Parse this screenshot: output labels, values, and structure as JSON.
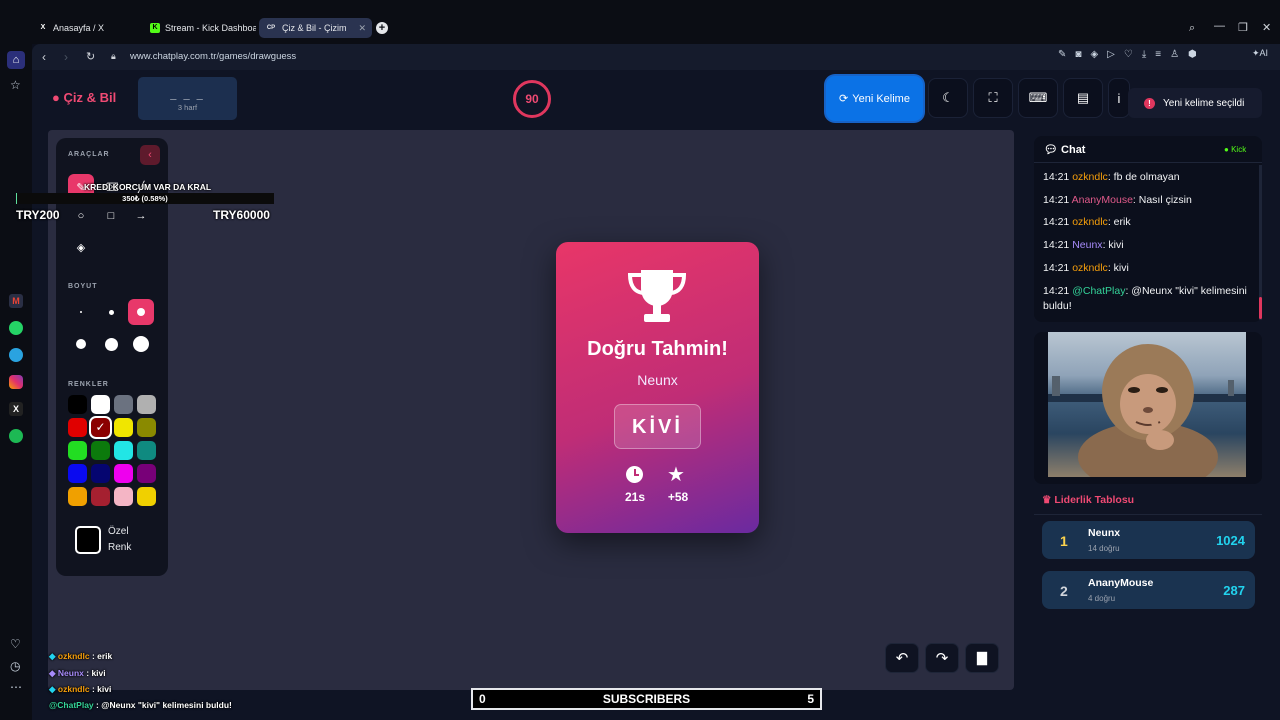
{
  "browser": {
    "tabs": [
      {
        "label": "Anasayfa / X",
        "favicon": "X"
      },
      {
        "label": "Stream - Kick Dashboard",
        "favicon": "K"
      },
      {
        "label": "Çiz & Bil - Çizim Oyun",
        "favicon": "CP"
      }
    ],
    "url": "www.chatplay.com.tr/games/drawguess",
    "ai_label": "AI"
  },
  "app": {
    "logo": "Çiz & Bil",
    "word_mask": "_ _ _",
    "word_hint": "3 harf",
    "timer": "90",
    "new_word_label": "Yeni Kelime",
    "toast": "Yeni kelime seçildi"
  },
  "tools": {
    "section_tools": "ARAÇLAR",
    "section_size": "BOYUT",
    "section_colors": "RENKLER",
    "custom_color_line1": "Özel",
    "custom_color_line2": "Renk",
    "colors": [
      "#000000",
      "#ffffff",
      "#6b7280",
      "#b0b0b0",
      "#e00000",
      "#8b0000",
      "#f0e600",
      "#8a8a00",
      "#22dd22",
      "#0c7a0c",
      "#22e5e5",
      "#0f8a80",
      "#0a0af0",
      "#050570",
      "#ee00ee",
      "#780078",
      "#f0a000",
      "#a52030",
      "#f4b5c5",
      "#f0d000"
    ],
    "selected_color_index": 5
  },
  "overlay_goal": {
    "text": "KREDI KORCUM VAR DA KRAL",
    "progress": "350₺ (0.58%)",
    "progress_fraction": 0.0058,
    "left": "TRY200",
    "right": "TRY60000"
  },
  "result_card": {
    "title": "Doğru Tahmin!",
    "player": "Neunx",
    "word": "KİVİ",
    "time": "21s",
    "points": "+58"
  },
  "chat": {
    "title": "Chat",
    "platform": "Kick",
    "messages": [
      {
        "time": "14:21",
        "user": "ozkndlc",
        "color": "#f59e0b",
        "text": ": fb de olmayan"
      },
      {
        "time": "14:21",
        "user": "AnanyMouse",
        "color": "#e05a8a",
        "text": ": Nasıl çizsin"
      },
      {
        "time": "14:21",
        "user": "ozkndlc",
        "color": "#f59e0b",
        "text": ": erik"
      },
      {
        "time": "14:21",
        "user": "Neunx",
        "color": "#a78bfa",
        "text": ": kivi"
      },
      {
        "time": "14:21",
        "user": "ozkndlc",
        "color": "#f59e0b",
        "text": ": kivi"
      },
      {
        "time": "14:21",
        "user": "@ChatPlay",
        "color": "#34d399",
        "text": ": @Neunx \"kivi\" kelimesini buldu!"
      }
    ]
  },
  "leaderboard": {
    "title": "Liderlik Tablosu",
    "rows": [
      {
        "rank": "1",
        "name": "Neunx",
        "sub": "14 doğru",
        "score": "1024"
      },
      {
        "rank": "2",
        "name": "AnanyMouse",
        "sub": "4 doğru",
        "score": "287"
      }
    ]
  },
  "stream_overlay": {
    "chat": [
      {
        "user": "ozkndlc",
        "text": " : erik"
      },
      {
        "user": "Neunx",
        "text": " : kivi"
      },
      {
        "user": "ozkndlc",
        "text": " : kivi"
      },
      {
        "user": "@ChatPlay",
        "text": " : @Neunx \"kivi\" kelimesini buldu!"
      }
    ],
    "sub_left": "0",
    "sub_label": "SUBSCRIBERS",
    "sub_right": "5"
  }
}
